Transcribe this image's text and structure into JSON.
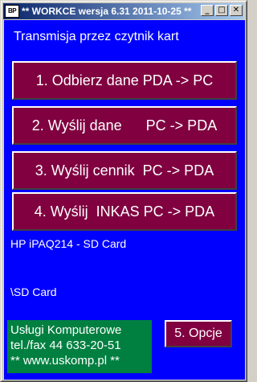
{
  "window": {
    "app_icon_text": "BP",
    "title": "** WORKCE wersja 6.31  2011-10-25 **",
    "minimize_glyph": "_",
    "maximize_glyph": "□",
    "close_glyph": "✕"
  },
  "main": {
    "heading": "Transmisja przez czytnik kart",
    "buttons": [
      {
        "label": "1. Odbierz dane PDA -> PC"
      },
      {
        "label": "2. Wyślij dane      PC -> PDA"
      },
      {
        "label": "3. Wyślij cennik  PC -> PDA"
      },
      {
        "label": "4. Wyślij  INKAS PC -> PDA"
      }
    ],
    "device": "HP iPAQ214 - SD Card",
    "path": "\\SD Card",
    "company": {
      "line1": "Usługi Komputerowe",
      "line2": "tel./fax 44 633-20-51",
      "line3": "** www.uskomp.pl **"
    },
    "options_label": "5. Opcje"
  },
  "colors": {
    "background": "#0000ff",
    "button": "#800040",
    "company_box": "#008040",
    "title_bar": "#0a246a"
  }
}
